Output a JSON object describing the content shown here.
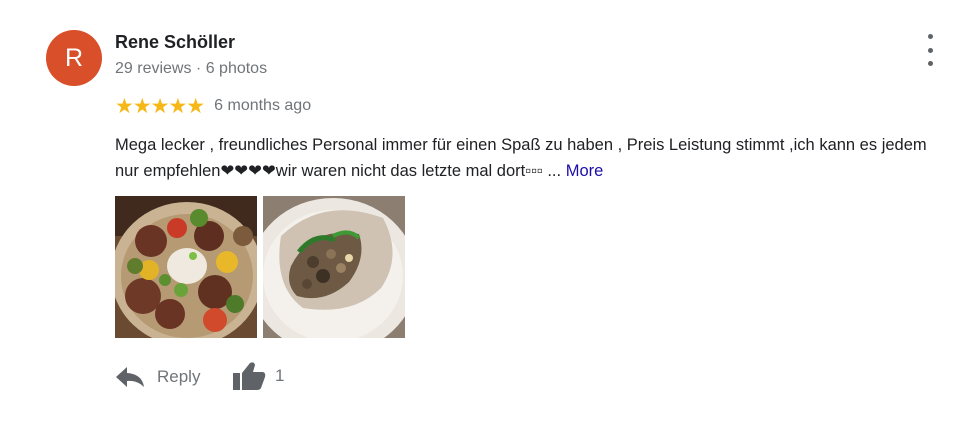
{
  "author": {
    "avatar_letter": "R",
    "avatar_color": "#d84f2a",
    "name": "Rene Schöller",
    "stats": "29 reviews · 6 photos"
  },
  "review": {
    "rating": 5,
    "rating_max": 5,
    "stars_display": "★★★★★",
    "star_color": "#f6b818",
    "date": "6 months ago",
    "text": "Mega lecker , freundliches Personal immer für einen Spaß zu haben , Preis Leistung stimmt ,ich kann es jedem nur empfehlen❤❤❤❤wir waren nicht das letzte mal dort▫▫▫ ... ",
    "more_label": "More",
    "link_color": "#1a0dab"
  },
  "photos": [
    {
      "icon": "food-photo-injera-platter"
    },
    {
      "icon": "food-photo-injera-wrap"
    }
  ],
  "actions": {
    "reply_label": "Reply",
    "reply_icon": "reply-arrow-icon",
    "like_icon": "thumbs-up-icon",
    "like_count": "1",
    "menu_icon": "more-vertical-icon"
  }
}
